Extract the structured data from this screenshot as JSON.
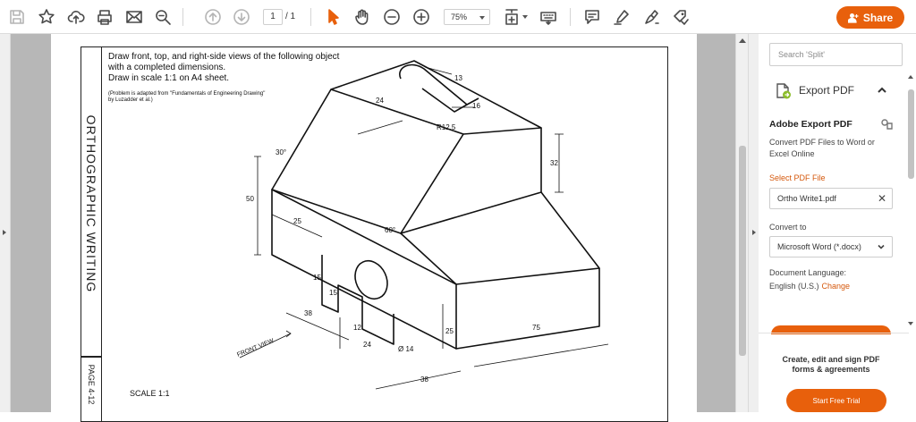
{
  "toolbar": {
    "icons": [
      "save-icon",
      "bookmark-star-icon",
      "upload-cloud-icon",
      "print-icon",
      "email-icon",
      "search-zoom-icon",
      "prev-page-icon",
      "next-page-icon",
      "select-cursor-icon",
      "hand-tool-icon",
      "zoom-out-icon",
      "zoom-in-icon",
      "page-fit-icon",
      "keyboard-icon",
      "comment-icon",
      "highlight-pen-icon",
      "draw-icon",
      "fill-sign-icon"
    ],
    "page_current": "1",
    "page_total": "/ 1",
    "zoom": "75%",
    "share_label": "Share"
  },
  "document": {
    "side_title": "ORTHOGRAPHIC  WRITING",
    "page_label": "PAGE 4-12",
    "instructions": [
      "Draw front, top, and right-side views of the following object",
      "with a completed dimensions.",
      "Draw in scale 1:1 on A4 sheet."
    ],
    "note": [
      "(Problem is adapted from \"Fundamentals of Engineering Drawing\"",
      "  by Luzadder et al.)"
    ],
    "scale": "SCALE 1:1",
    "front_view_label": "FRONT VIEW",
    "dimensions": {
      "d24_top": "24",
      "d13": "13",
      "d16": "16",
      "r12": "R12.5",
      "a30": "30°",
      "d32": "32",
      "d50": "50",
      "d25": "25",
      "a60": "60°",
      "d15a": "15",
      "d15b": "15",
      "d38a": "38",
      "d12": "12",
      "d24_bot": "24",
      "dia14": "Ø 14",
      "d25v": "25",
      "d75": "75",
      "d38b": "38"
    }
  },
  "panel": {
    "search_placeholder": "Search 'Split'",
    "export_title": "Export PDF",
    "adobe_title": "Adobe Export PDF",
    "adobe_desc": "Convert PDF Files to Word or Excel Online",
    "select_label": "Select PDF File",
    "file_name": "Ortho Write1.pdf",
    "convert_label": "Convert to",
    "convert_value": "Microsoft Word (*.docx)",
    "lang_label": "Document Language:",
    "lang_value": "English (U.S.)",
    "lang_change": "Change",
    "promo_text": "Create, edit and sign PDF forms & agreements",
    "trial_label": "Start Free Trial"
  },
  "colors": {
    "accent": "#e8600c",
    "doc_background": "#b7b7b7"
  }
}
